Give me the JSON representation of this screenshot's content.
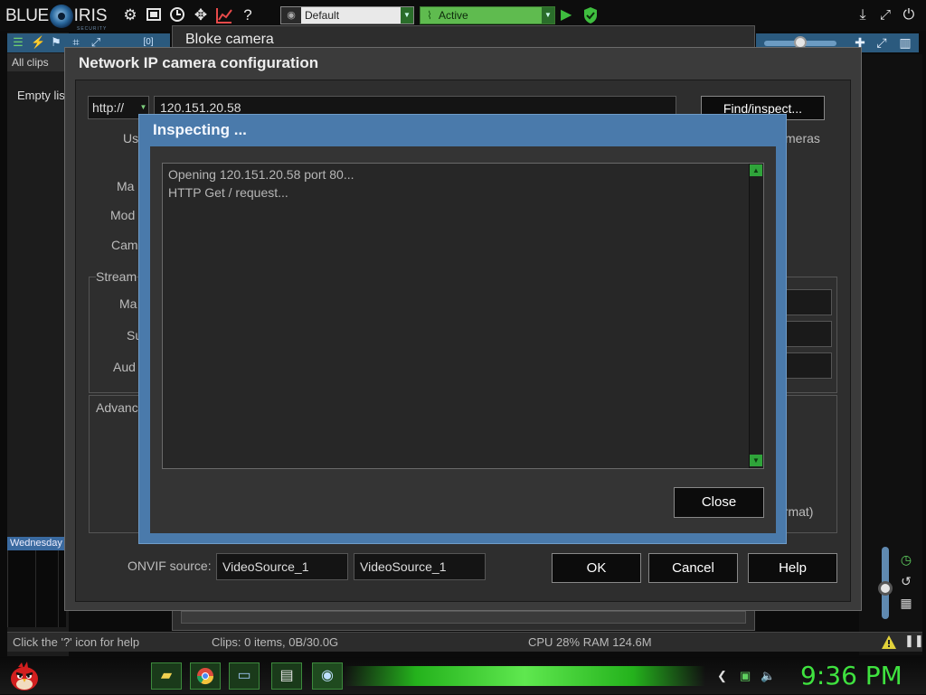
{
  "topbar": {
    "logo_word1": "BLUE",
    "logo_word2": "IRIS",
    "logo_tagline": "SECURITY",
    "profile_selected": "Default",
    "schedule_selected": "Active",
    "icons": [
      "gear-icon",
      "clapper-icon",
      "clock-icon",
      "move-icon",
      "chart-icon",
      "help-icon",
      "play-icon",
      "shield-icon",
      "download-icon",
      "fullscreen-icon",
      "power-icon"
    ]
  },
  "left_panel": {
    "count_badge": "[0]",
    "filter_label": "All clips",
    "empty_text": "Empty lis",
    "date_label": "Wednesday"
  },
  "bloke_camera": {
    "title": "Bloke camera"
  },
  "network_dialog": {
    "title": "Network IP camera configuration",
    "protocol": "http://",
    "address": "120.151.20.58",
    "find_button": "Find/inspect...",
    "labels": {
      "user": "Us",
      "make": "Ma",
      "model": "Mod",
      "camera": "Cam",
      "streams": "Stream",
      "main": "Ma",
      "sub": "Su",
      "audio": "Aud",
      "advanced": "Advanc",
      "cameras_suffix": "meras",
      "format_suffix": "ormat)"
    },
    "onvif_label": "ONVIF source:",
    "onvif_value1": "VideoSource_1",
    "onvif_value2": "VideoSource_1",
    "ok_button": "OK",
    "cancel_button": "Cancel",
    "help_button": "Help"
  },
  "inspect_dialog": {
    "title": "Inspecting ...",
    "log_lines": [
      "Opening 120.151.20.58 port 80...",
      "HTTP Get / request..."
    ],
    "close_button": "Close"
  },
  "statusbar": {
    "help_text": "Click the '?' icon for help",
    "clips_text": "Clips: 0 items, 0B/30.0G",
    "resources_text": "CPU 28% RAM 124.6M"
  },
  "taskbar": {
    "clock": "9:36 PM",
    "apps": [
      "folder-icon",
      "chrome-icon",
      "window-icon",
      "notepad-icon",
      "blueiris-icon"
    ]
  },
  "colors": {
    "accent_blue": "#4a7aab",
    "schedule_green": "#5fbb4f",
    "clock_green": "#3fe23f"
  }
}
